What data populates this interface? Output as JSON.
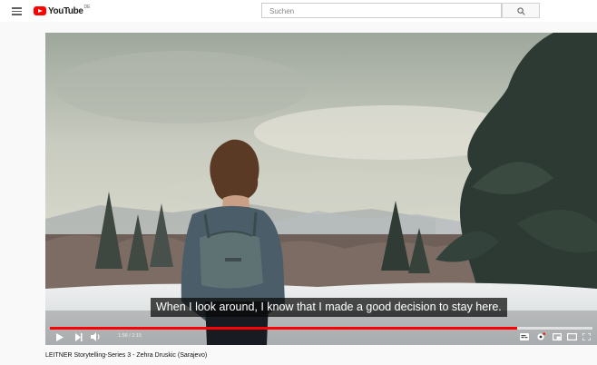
{
  "masthead": {
    "logo_text": "YouTube",
    "logo_country": "DE",
    "search_placeholder": "Suchen"
  },
  "player": {
    "subtitle": "When I look around, I know that I made a good decision to stay here.",
    "time_current": "1:56",
    "time_separator": " / ",
    "time_total": "2:15",
    "progress_fraction": 0.862,
    "buffered_fraction": 1.0,
    "progress_color": "#ff0000"
  },
  "video": {
    "title": "LEITNER Storytelling-Series 3 - Zehra Druskic (Sarajevo)"
  },
  "icons": {
    "menu": "hamburger-menu-icon",
    "search": "search-icon",
    "play": "play-icon",
    "next": "next-icon",
    "volume": "volume-icon",
    "subtitles": "subtitles-icon",
    "settings": "settings-gear-icon",
    "miniplayer": "miniplayer-icon",
    "theater": "theater-mode-icon",
    "fullscreen": "fullscreen-icon"
  }
}
